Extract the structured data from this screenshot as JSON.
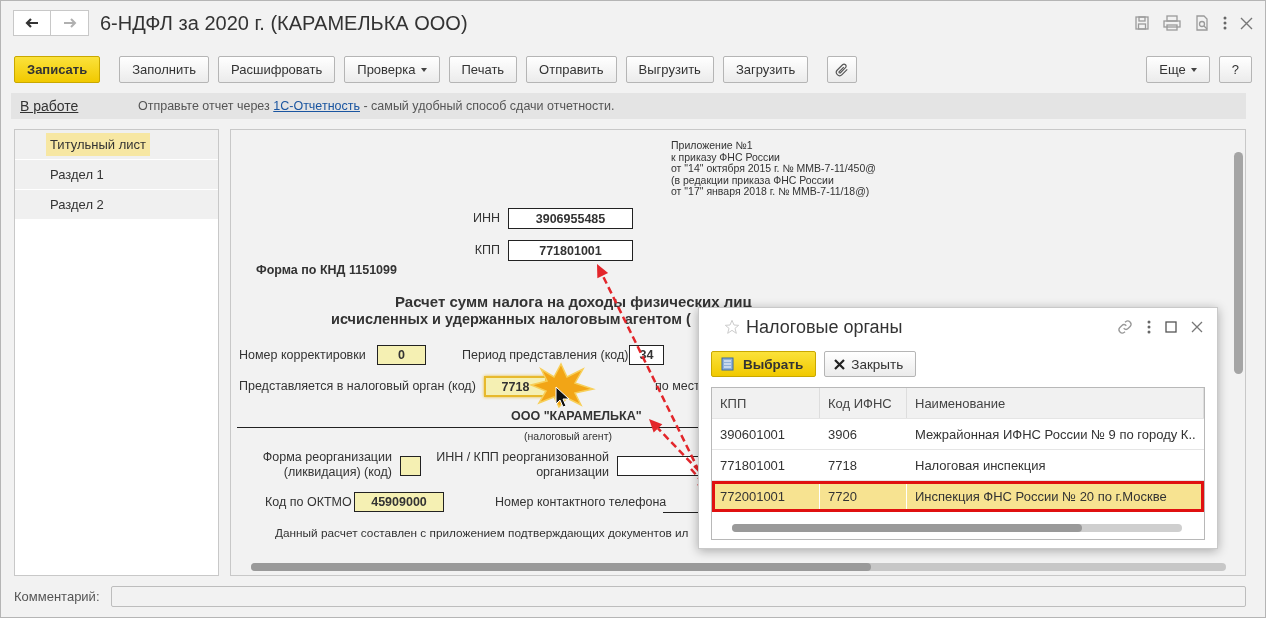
{
  "window": {
    "title": "6-НДФЛ за 2020 г. (КАРАМЕЛЬКА ООО)"
  },
  "toolbar": {
    "buttons": [
      {
        "label": "Записать",
        "kind": "primary"
      },
      {
        "label": "Заполнить",
        "kind": "plain"
      },
      {
        "label": "Расшифровать",
        "kind": "plain"
      },
      {
        "label": "Проверка",
        "kind": "dropdown"
      },
      {
        "label": "Печать",
        "kind": "plain"
      },
      {
        "label": "Отправить",
        "kind": "plain"
      },
      {
        "label": "Выгрузить",
        "kind": "plain"
      },
      {
        "label": "Загрузить",
        "kind": "plain"
      },
      {
        "kind": "attach"
      }
    ],
    "right_buttons": [
      {
        "label": "Еще",
        "kind": "dropdown"
      },
      {
        "label": "?",
        "kind": "plain"
      }
    ]
  },
  "status_bar": {
    "state": "В работе",
    "message_before": "Отправьте отчет через ",
    "link": "1С-Отчетность",
    "message_after": " - самый удобный способ сдачи отчетности."
  },
  "sidebar": {
    "items": [
      {
        "label": "Титульный лист",
        "selected": true
      },
      {
        "label": "Раздел 1",
        "selected": false
      },
      {
        "label": "Раздел 2",
        "selected": false
      }
    ]
  },
  "document": {
    "header_lines": [
      "Приложение №1",
      "к приказу ФНС России",
      "от \"14\" октября 2015 г. № ММВ-7-11/450@",
      "(в редакции приказа ФНС России",
      "от \"17\" января 2018 г. № ММВ-7-11/18@)"
    ],
    "inn": {
      "label": "ИНН",
      "value": "3906955485"
    },
    "kpp": {
      "label": "КПП",
      "value": "771801001"
    },
    "form_code": "Форма по КНД 1151099",
    "title_lines": [
      "Расчет сумм налога на доходы физических лиц",
      "исчисленных и удержанных налоговым агентом ("
    ],
    "correction": {
      "label": "Номер корректировки",
      "value": "0",
      "editable": true
    },
    "period": {
      "label": "Период представления (код)",
      "value": "34",
      "editable": false
    },
    "tax_authority": {
      "label": "Представляется в налоговый орган (код)",
      "value": "7718",
      "editable": true,
      "focused": true
    },
    "location_hint": "по мест",
    "agent_name": "ООО \"КАРАМЕЛЬКА\"",
    "agent_caption": "(налоговый агент)",
    "reorg_form": {
      "label_lines": [
        "Форма реорганизации",
        "(ликвидация) (код)"
      ],
      "editable": true
    },
    "reorg_inn": {
      "label_lines": [
        "ИНН / КПП реорганизованной",
        "организации"
      ],
      "editable": false
    },
    "oktmo": {
      "label": "Код по ОКТМО",
      "value": "45909000",
      "editable": true
    },
    "phone": {
      "label": "Номер контактного телефона"
    },
    "note": "Данный расчет составлен с приложением подтверждающих документов ил"
  },
  "popup": {
    "title": "Налоговые органы",
    "buttons": [
      {
        "label": "Выбрать",
        "kind": "primary"
      },
      {
        "label": "Закрыть",
        "kind": "close"
      }
    ],
    "table": {
      "columns": [
        "КПП",
        "Код ИФНС",
        "Наименование"
      ],
      "rows": [
        {
          "cells": [
            "390601001",
            "3906",
            "Межрайонная ИФНС России № 9 по городу К.."
          ],
          "selected": false
        },
        {
          "cells": [
            "771801001",
            "7718",
            "Налоговая инспекция"
          ],
          "selected": false
        },
        {
          "cells": [
            "772001001",
            "7720",
            "Инспекция ФНС России № 20 по г.Москве"
          ],
          "selected": true
        }
      ]
    }
  },
  "comment": {
    "label": "Комментарий:"
  }
}
